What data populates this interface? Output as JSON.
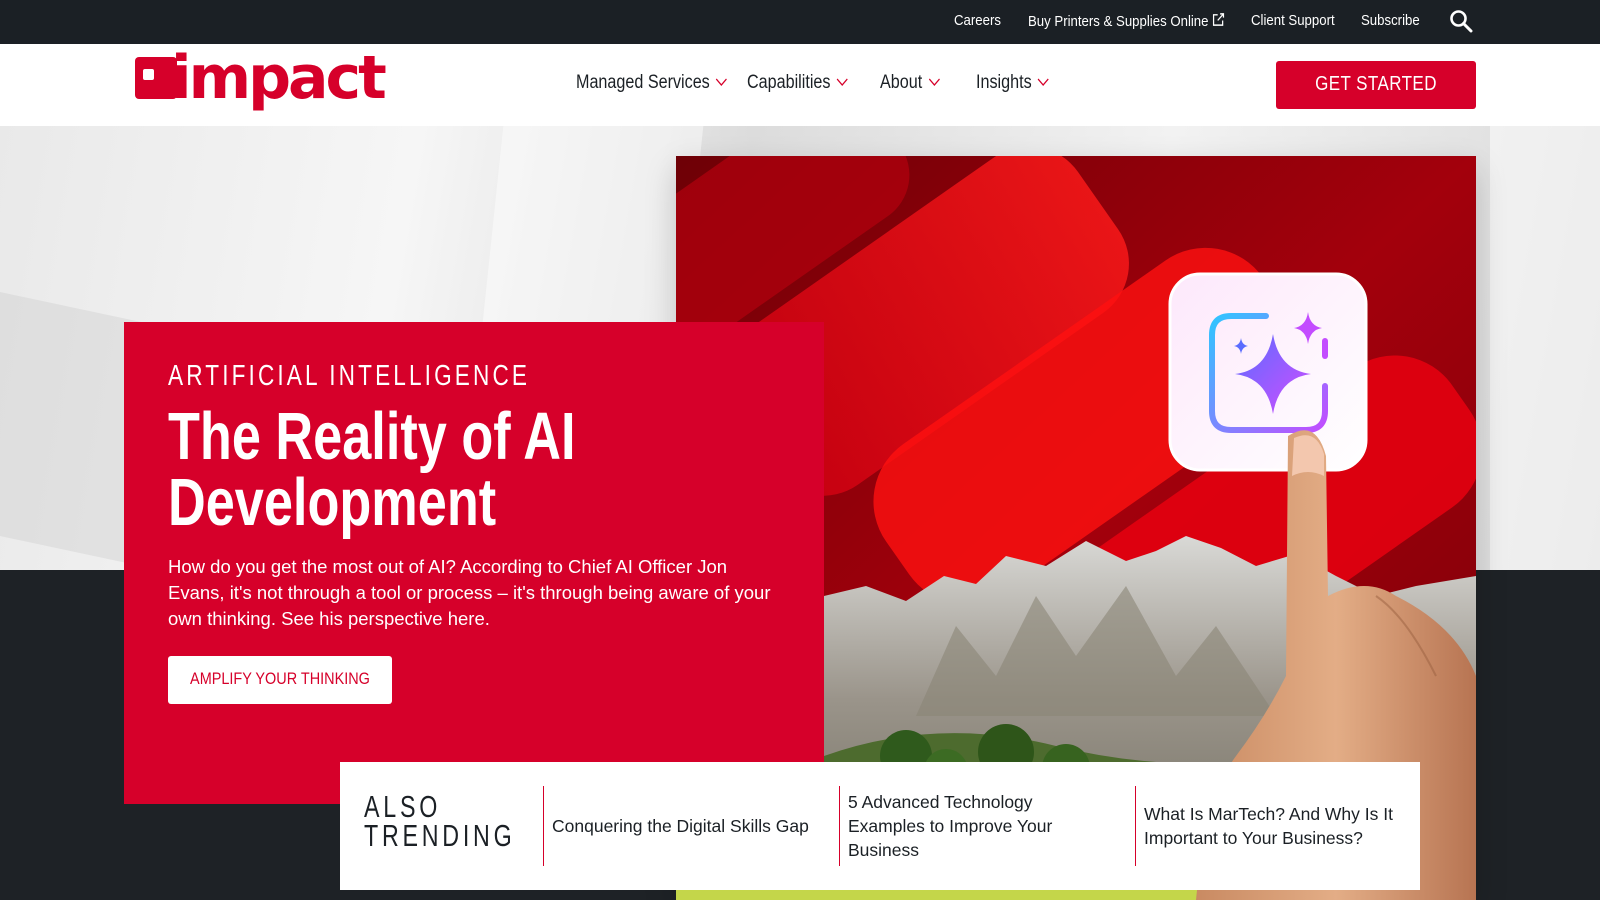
{
  "utility_nav": {
    "links": [
      {
        "label": "Careers"
      },
      {
        "label": "Buy Printers & Supplies Online"
      },
      {
        "label": "Client Support"
      },
      {
        "label": "Subscribe"
      }
    ],
    "search_icon": "search-icon",
    "external_icon": "external-link-icon"
  },
  "header": {
    "logo_text": "impact",
    "nav": [
      {
        "label": "Managed Services"
      },
      {
        "label": "Capabilities"
      },
      {
        "label": "About"
      },
      {
        "label": "Insights"
      }
    ],
    "cta_label": "GET STARTED"
  },
  "hero": {
    "eyebrow": "ARTIFICIAL INTELLIGENCE",
    "title_line1": "The Reality of AI",
    "title_line2": "Development",
    "description": "How do you get the most out of AI? According to Chief AI Officer Jon Evans, it's not through a tool or process – it's through being aware of your own thinking. See his perspective here.",
    "button_label": "AMPLIFY YOUR THINKING"
  },
  "trending": {
    "label_line1": "ALSO",
    "label_line2": "TRENDING",
    "items": [
      {
        "title": "Conquering the Digital Skills Gap"
      },
      {
        "title": "5 Advanced Technology Examples to Improve Your Business"
      },
      {
        "title": "What Is MarTech? And Why Is It Important to Your Business?"
      }
    ]
  },
  "colors": {
    "brand_red": "#d6002a",
    "dark": "#1b2025",
    "white": "#ffffff"
  }
}
